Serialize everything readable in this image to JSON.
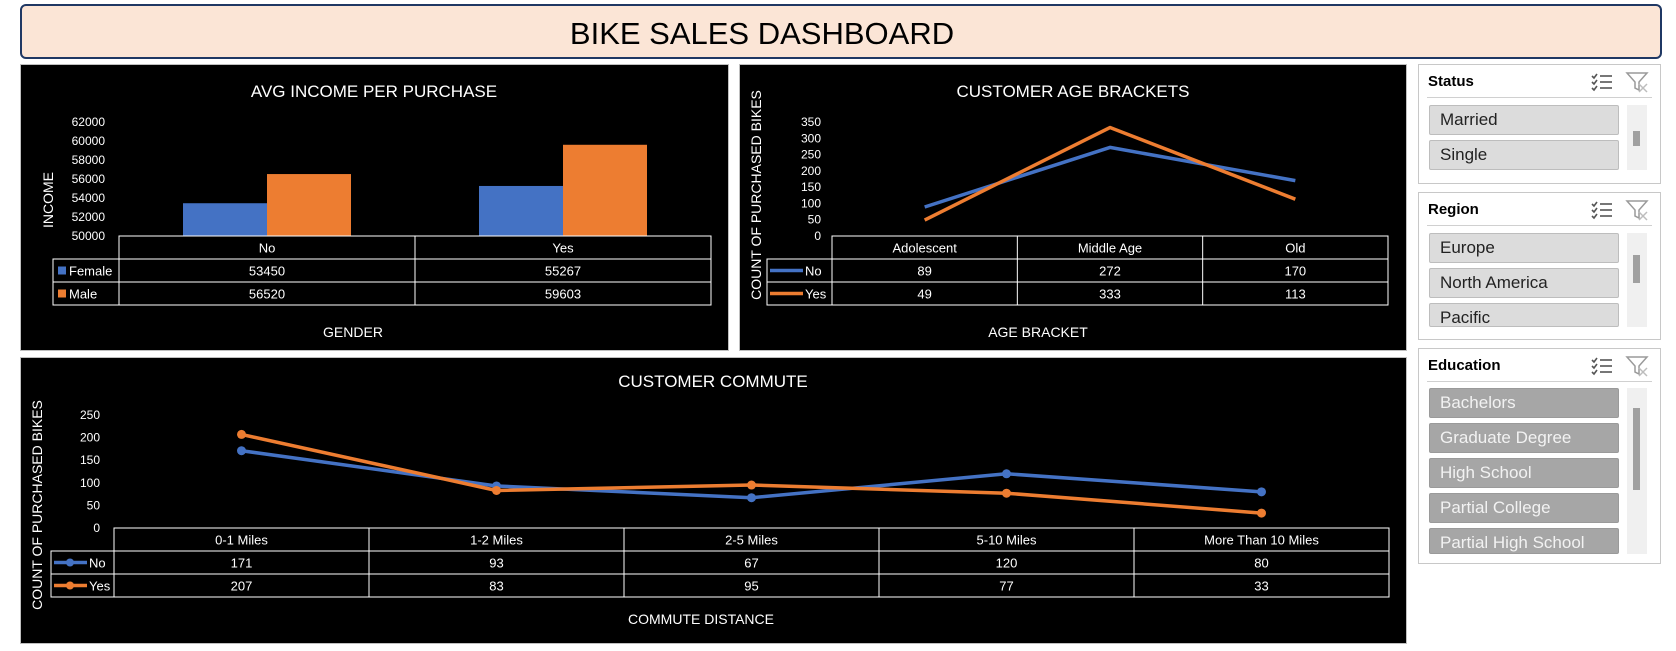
{
  "dashboard": {
    "title": "BIKE SALES DASHBOARD"
  },
  "colors": {
    "no": "#4472c4",
    "yes": "#ed7d31",
    "panel_bg": "#000000",
    "title_bg": "#fbe5d6"
  },
  "chart_data": [
    {
      "type": "bar",
      "title": "AVG INCOME PER PURCHASE",
      "xlabel": "GENDER",
      "ylabel": "INCOME",
      "categories": [
        "No",
        "Yes"
      ],
      "series": [
        {
          "name": "Female",
          "values": [
            53450,
            55267
          ]
        },
        {
          "name": "Male",
          "values": [
            56520,
            59603
          ]
        }
      ],
      "ylim": [
        50000,
        62000
      ],
      "yticks": [
        "62000",
        "60000",
        "58000",
        "56000",
        "54000",
        "52000",
        "50000"
      ],
      "data_table": true
    },
    {
      "type": "line",
      "title": "CUSTOMER AGE BRACKETS",
      "xlabel": "AGE BRACKET",
      "ylabel": "COUNT OF PURCHASED BIKES",
      "categories": [
        "Adolescent",
        "Middle Age",
        "Old"
      ],
      "series": [
        {
          "name": "No",
          "values": [
            89,
            272,
            170
          ]
        },
        {
          "name": "Yes",
          "values": [
            49,
            333,
            113
          ]
        }
      ],
      "ylim": [
        0,
        350
      ],
      "yticks": [
        "350",
        "300",
        "250",
        "200",
        "150",
        "100",
        "50",
        "0"
      ],
      "data_table": true
    },
    {
      "type": "line",
      "title": "CUSTOMER COMMUTE",
      "xlabel": "COMMUTE DISTANCE",
      "ylabel": "COUNT OF PURCHASED BIKES",
      "categories": [
        "0-1 Miles",
        "1-2 Miles",
        "2-5 Miles",
        "5-10 Miles",
        "More Than 10 Miles"
      ],
      "series": [
        {
          "name": "No",
          "values": [
            171,
            93,
            67,
            120,
            80
          ]
        },
        {
          "name": "Yes",
          "values": [
            207,
            83,
            95,
            77,
            33
          ]
        }
      ],
      "ylim": [
        0,
        250
      ],
      "yticks": [
        "250",
        "200",
        "150",
        "100",
        "50",
        "0"
      ],
      "markers": true,
      "data_table": true
    }
  ],
  "slicers": {
    "status": {
      "title": "Status",
      "items": [
        "Married",
        "Single"
      ],
      "icons": [
        "multi-select-icon",
        "clear-filter-icon"
      ]
    },
    "region": {
      "title": "Region",
      "items": [
        "Europe",
        "North America",
        "Pacific"
      ],
      "icons": [
        "multi-select-icon",
        "clear-filter-icon"
      ]
    },
    "education": {
      "title": "Education",
      "items": [
        "Bachelors",
        "Graduate Degree",
        "High School",
        "Partial College",
        "Partial High School"
      ],
      "icons": [
        "multi-select-icon",
        "clear-filter-icon"
      ]
    }
  }
}
